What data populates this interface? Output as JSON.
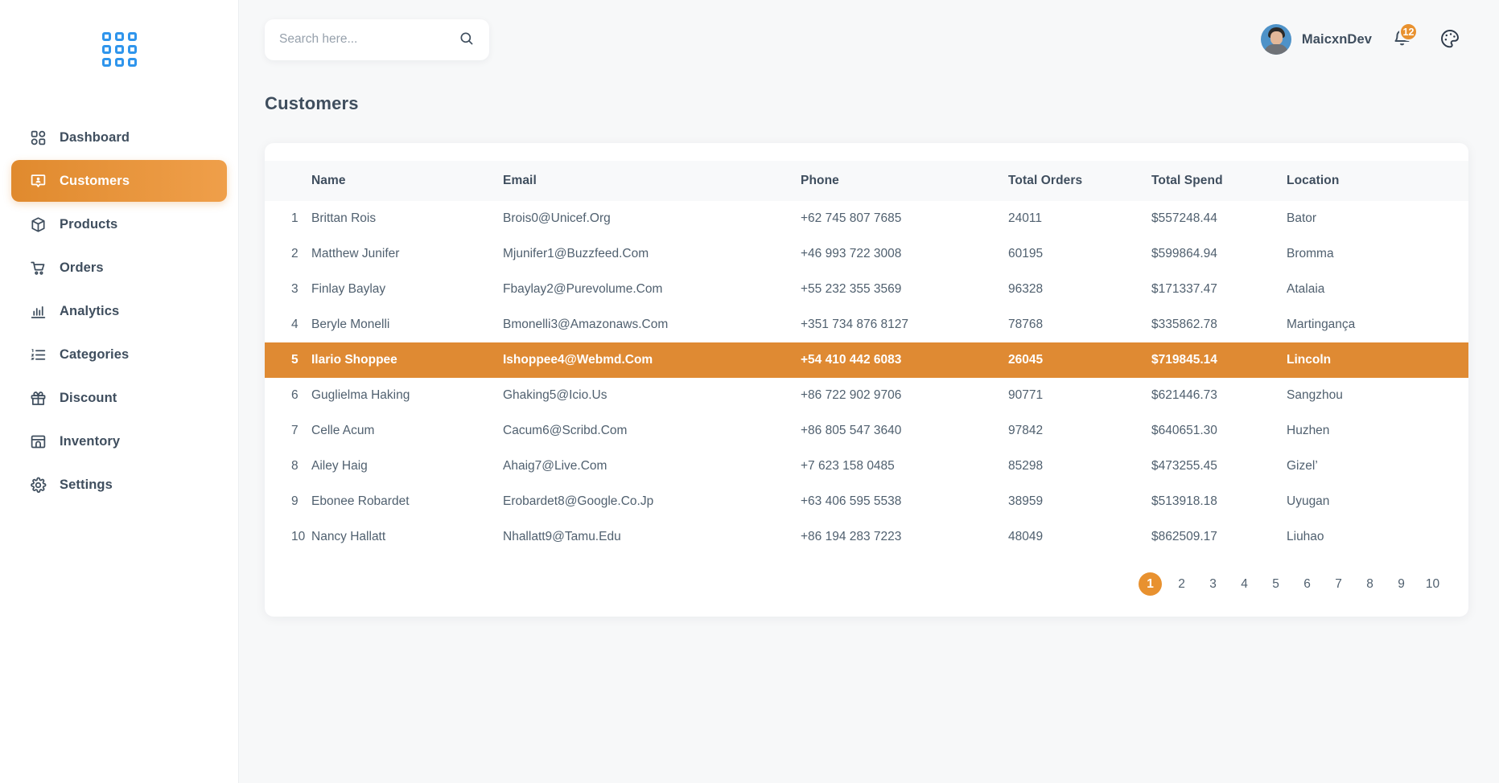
{
  "brand": {
    "logo_icon": "grid-logo-icon",
    "logo_color": "#2f95ec"
  },
  "theme": {
    "accent": "#e8912f",
    "accent_dark": "#e08a2e",
    "accent_light": "#ef9f4a",
    "row_highlight": "#df8a33",
    "text": "#3f4e5e",
    "page_bg": "#f7f8f9",
    "card_bg": "#ffffff"
  },
  "sidebar": {
    "items": [
      {
        "label": "Dashboard",
        "icon": "dashboard-grid-icon",
        "active": false
      },
      {
        "label": "Customers",
        "icon": "customers-icon",
        "active": true
      },
      {
        "label": "Products",
        "icon": "box-icon",
        "active": false
      },
      {
        "label": "Orders",
        "icon": "cart-icon",
        "active": false
      },
      {
        "label": "Analytics",
        "icon": "bar-chart-icon",
        "active": false
      },
      {
        "label": "Categories",
        "icon": "ordered-list-icon",
        "active": false
      },
      {
        "label": "Discount",
        "icon": "gift-icon",
        "active": false
      },
      {
        "label": "Inventory",
        "icon": "store-icon",
        "active": false
      },
      {
        "label": "Settings",
        "icon": "gear-icon",
        "active": false
      }
    ]
  },
  "topbar": {
    "search": {
      "placeholder": "Search here...",
      "value": "",
      "icon": "search-icon"
    },
    "user": {
      "name": "MaicxnDev",
      "avatar": "user-avatar"
    },
    "notifications": {
      "icon": "bell-icon",
      "count": "12"
    },
    "theme_toggle": {
      "icon": "palette-icon"
    }
  },
  "page": {
    "title": "Customers"
  },
  "table": {
    "columns": [
      "",
      "Name",
      "Email",
      "Phone",
      "Total Orders",
      "Total Spend",
      "Location"
    ],
    "rows": [
      {
        "idx": "1",
        "name": "Brittan Rois",
        "email": "Brois0@Unicef.Org",
        "phone": "+62 745 807 7685",
        "orders": "24011",
        "spend": "$557248.44",
        "location": "Bator",
        "highlight": false
      },
      {
        "idx": "2",
        "name": "Matthew Junifer",
        "email": "Mjunifer1@Buzzfeed.Com",
        "phone": "+46 993 722 3008",
        "orders": "60195",
        "spend": "$599864.94",
        "location": "Bromma",
        "highlight": false
      },
      {
        "idx": "3",
        "name": "Finlay Baylay",
        "email": "Fbaylay2@Purevolume.Com",
        "phone": "+55 232 355 3569",
        "orders": "96328",
        "spend": "$171337.47",
        "location": "Atalaia",
        "highlight": false
      },
      {
        "idx": "4",
        "name": "Beryle Monelli",
        "email": "Bmonelli3@Amazonaws.Com",
        "phone": "+351 734 876 8127",
        "orders": "78768",
        "spend": "$335862.78",
        "location": "Martingança",
        "highlight": false
      },
      {
        "idx": "5",
        "name": "Ilario Shoppee",
        "email": "Ishoppee4@Webmd.Com",
        "phone": "+54 410 442 6083",
        "orders": "26045",
        "spend": "$719845.14",
        "location": "Lincoln",
        "highlight": true
      },
      {
        "idx": "6",
        "name": "Guglielma Haking",
        "email": "Ghaking5@Icio.Us",
        "phone": "+86 722 902 9706",
        "orders": "90771",
        "spend": "$621446.73",
        "location": "Sangzhou",
        "highlight": false
      },
      {
        "idx": "7",
        "name": "Celle Acum",
        "email": "Cacum6@Scribd.Com",
        "phone": "+86 805 547 3640",
        "orders": "97842",
        "spend": "$640651.30",
        "location": "Huzhen",
        "highlight": false
      },
      {
        "idx": "8",
        "name": "Ailey Haig",
        "email": "Ahaig7@Live.Com",
        "phone": "+7 623 158 0485",
        "orders": "85298",
        "spend": "$473255.45",
        "location": "Gizel’",
        "highlight": false
      },
      {
        "idx": "9",
        "name": "Ebonee Robardet",
        "email": "Erobardet8@Google.Co.Jp",
        "phone": "+63 406 595 5538",
        "orders": "38959",
        "spend": "$513918.18",
        "location": "Uyugan",
        "highlight": false
      },
      {
        "idx": "10",
        "name": "Nancy Hallatt",
        "email": "Nhallatt9@Tamu.Edu",
        "phone": "+86 194 283 7223",
        "orders": "48049",
        "spend": "$862509.17",
        "location": "Liuhao",
        "highlight": false
      }
    ]
  },
  "pagination": {
    "pages": [
      "1",
      "2",
      "3",
      "4",
      "5",
      "6",
      "7",
      "8",
      "9",
      "10"
    ],
    "current": "1"
  }
}
